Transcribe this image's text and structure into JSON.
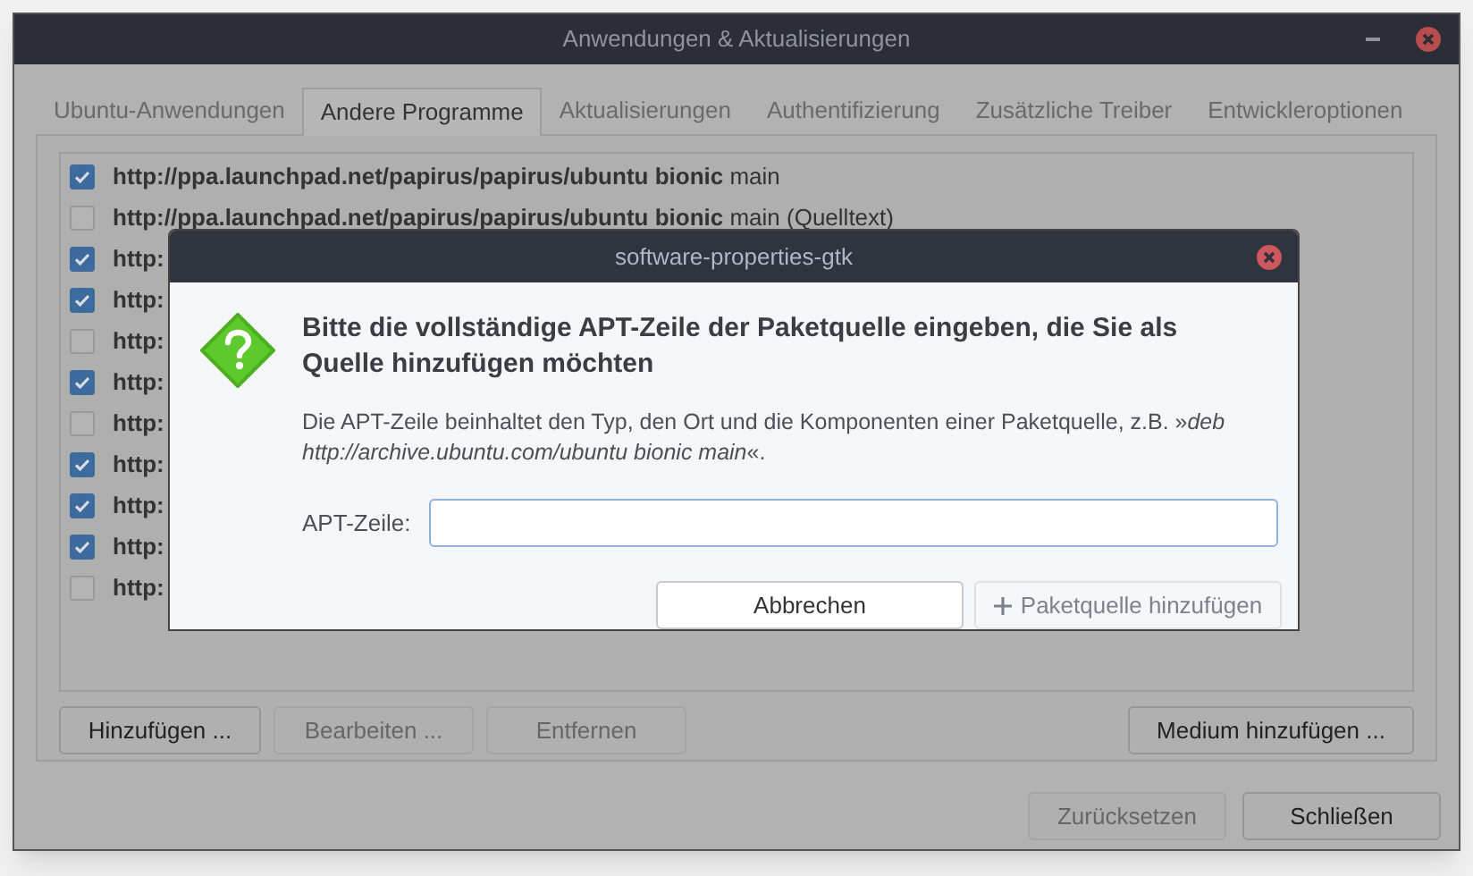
{
  "window": {
    "title": "Anwendungen & Aktualisierungen"
  },
  "tabs": [
    {
      "label": "Ubuntu-Anwendungen",
      "selected": false
    },
    {
      "label": "Andere Programme",
      "selected": true
    },
    {
      "label": "Aktualisierungen",
      "selected": false
    },
    {
      "label": "Authentifizierung",
      "selected": false
    },
    {
      "label": "Zusätzliche Treiber",
      "selected": false
    },
    {
      "label": "Entwickleroptionen",
      "selected": false
    }
  ],
  "sources": [
    {
      "checked": true,
      "location": "http://ppa.launchpad.net/papirus/papirus/ubuntu bionic",
      "components": "main"
    },
    {
      "checked": false,
      "location": "http://ppa.launchpad.net/papirus/papirus/ubuntu bionic",
      "components": "main (Quelltext)"
    },
    {
      "checked": true,
      "location": "http:"
    },
    {
      "checked": true,
      "location": "http:"
    },
    {
      "checked": false,
      "location": "http:"
    },
    {
      "checked": true,
      "location": "http:"
    },
    {
      "checked": false,
      "location": "http:"
    },
    {
      "checked": true,
      "location": "http:"
    },
    {
      "checked": true,
      "location": "http:"
    },
    {
      "checked": true,
      "location": "http:"
    },
    {
      "checked": false,
      "location": "http:"
    }
  ],
  "list_buttons": [
    {
      "label": "Hinzufügen ...",
      "disabled": false
    },
    {
      "label": "Bearbeiten ...",
      "disabled": true
    },
    {
      "label": "Entfernen",
      "disabled": true
    },
    {
      "label": "Medium hinzufügen ...",
      "disabled": false
    }
  ],
  "footer_buttons": [
    {
      "label": "Zurücksetzen",
      "disabled": true
    },
    {
      "label": "Schließen",
      "disabled": false
    }
  ],
  "dialog": {
    "title": "software-properties-gtk",
    "heading": "Bitte die vollständige APT-Zeile der Paketquelle eingeben, die Sie als Quelle hinzufügen möchten",
    "description": "Die APT-Zeile beinhaltet den Typ, den Ort und die Komponenten einer Paketquelle, z.B. »*deb http://archive.ubuntu.com/ubuntu bionic main*«.",
    "field_label": "APT-Zeile:",
    "buttons": [
      {
        "label": "Abbrechen",
        "disabled": false,
        "kind": "plain"
      },
      {
        "label": "Paketquelle hinzufügen",
        "disabled": true,
        "kind": "add"
      }
    ]
  }
}
